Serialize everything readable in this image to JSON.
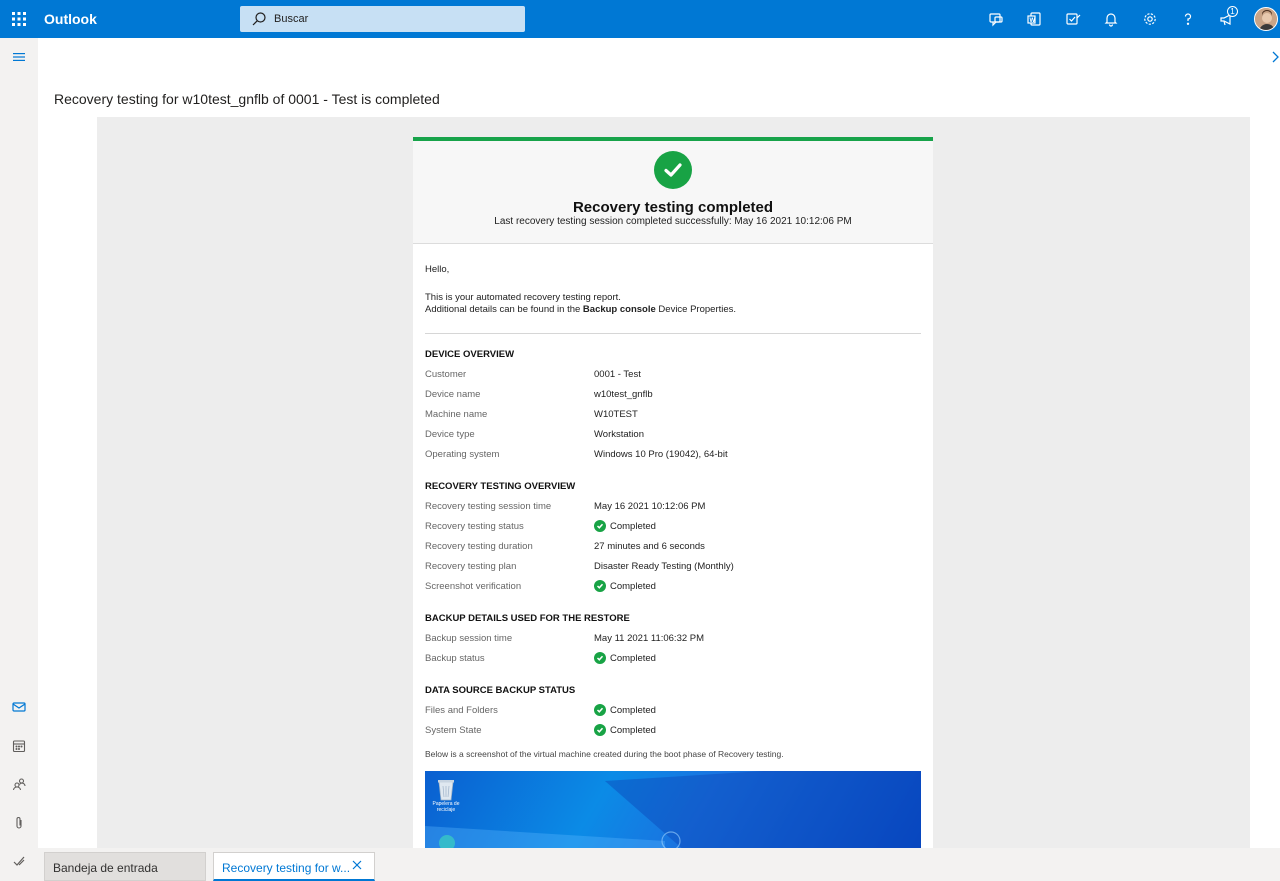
{
  "app": {
    "title": "Outlook"
  },
  "search": {
    "placeholder": "Buscar"
  },
  "notifications": {
    "count": "1"
  },
  "message": {
    "subject": "Recovery testing for w10test_gnflb of 0001 - Test is completed"
  },
  "email": {
    "hero_title": "Recovery testing completed",
    "hero_subtitle": "Last recovery testing session completed successfully: May 16 2021 10:12:06 PM",
    "greeting": "Hello,",
    "intro_line1": "This is your automated recovery testing report.",
    "intro_line2_pre": "Additional details can be found in the ",
    "intro_line2_bold": "Backup console",
    "intro_line2_post": " Device Properties.",
    "sections": [
      {
        "title": "DEVICE OVERVIEW",
        "rows": [
          {
            "key": "Customer",
            "value": "0001 - Test"
          },
          {
            "key": "Device name",
            "value": "w10test_gnflb"
          },
          {
            "key": "Machine name",
            "value": "W10TEST"
          },
          {
            "key": "Device type",
            "value": "Workstation"
          },
          {
            "key": "Operating system",
            "value": "Windows 10 Pro (19042), 64-bit"
          }
        ]
      },
      {
        "title": "RECOVERY TESTING OVERVIEW",
        "rows": [
          {
            "key": "Recovery testing session time",
            "value": "May 16 2021 10:12:06 PM"
          },
          {
            "key": "Recovery testing status",
            "value": "Completed"
          },
          {
            "key": "Recovery testing duration",
            "value": "27 minutes and 6 seconds"
          },
          {
            "key": "Recovery testing plan",
            "value": "Disaster Ready Testing (Monthly)"
          },
          {
            "key": "Screenshot verification",
            "value": "Completed"
          }
        ]
      },
      {
        "title": "BACKUP DETAILS USED FOR THE RESTORE",
        "rows": [
          {
            "key": "Backup session time",
            "value": "May 11 2021 11:06:32 PM"
          },
          {
            "key": "Backup status",
            "value": "Completed"
          }
        ]
      },
      {
        "title": "DATA SOURCE BACKUP STATUS",
        "rows": [
          {
            "key": "Files and Folders",
            "value": "Completed"
          },
          {
            "key": "System State",
            "value": "Completed"
          }
        ]
      }
    ],
    "screenshot_note": "Below is a screenshot of the virtual machine created during the boot phase of Recovery testing.",
    "vm_desktop_icon_label": "Papelera de reciclaje"
  },
  "tabs": [
    {
      "label": "Bandeja de entrada"
    },
    {
      "label": "Recovery testing for w..."
    }
  ],
  "colors": {
    "accent": "#0078d4",
    "success": "#18a345"
  }
}
